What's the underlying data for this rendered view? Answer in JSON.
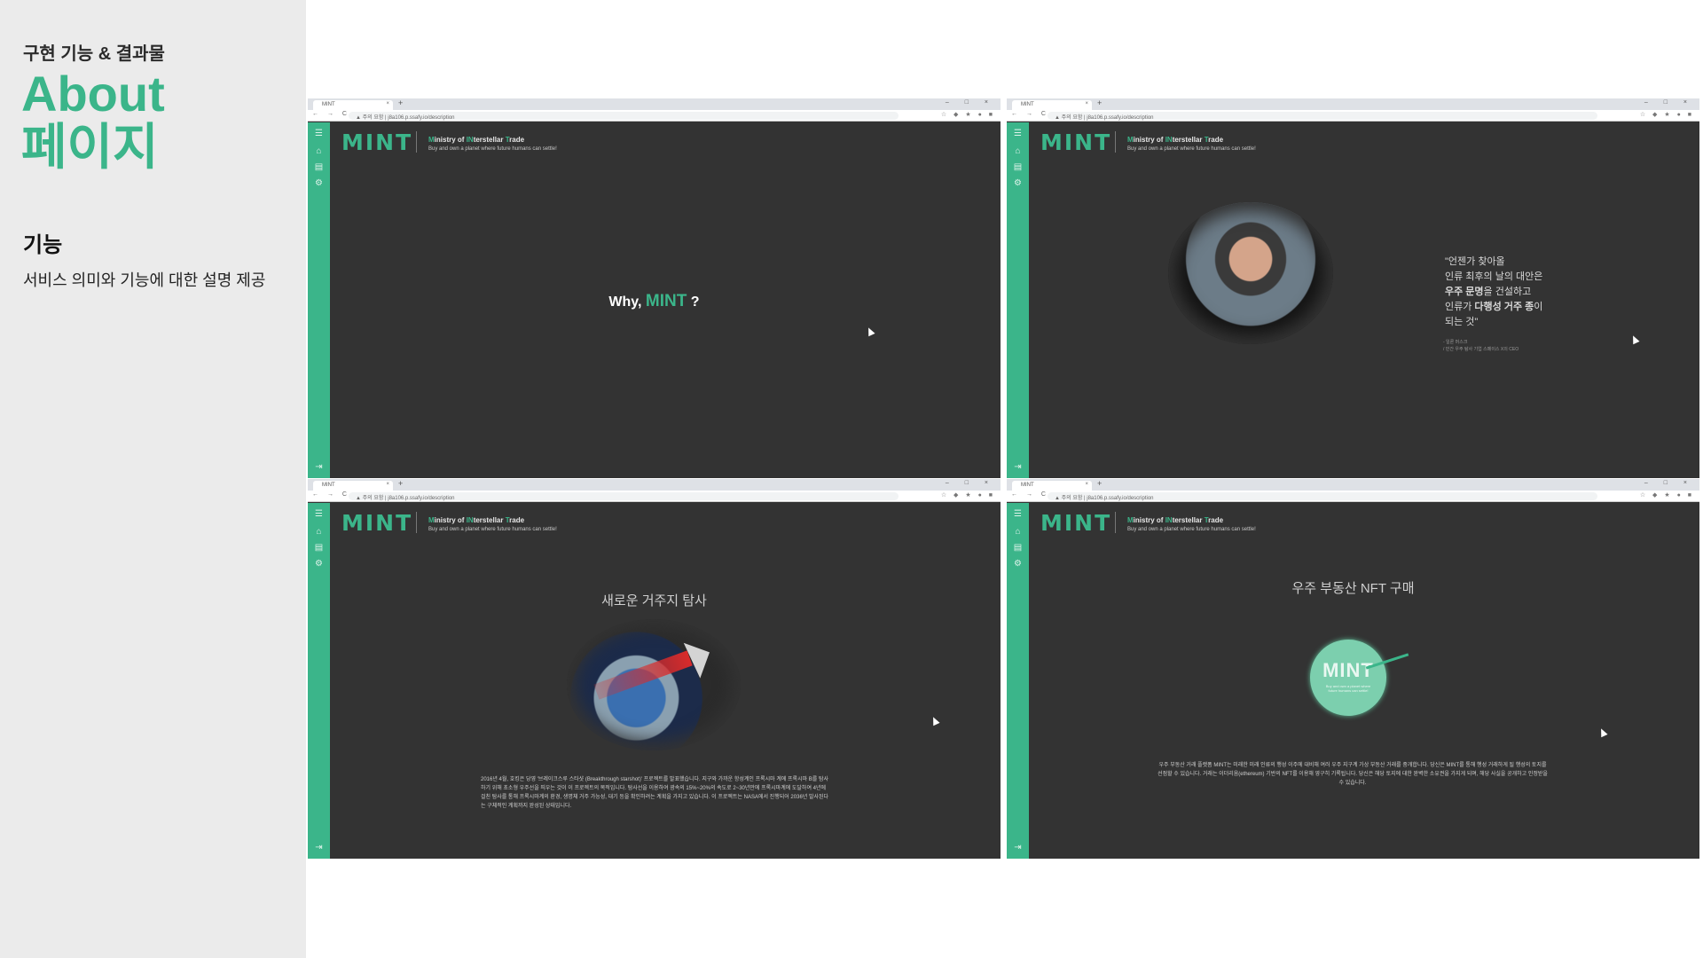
{
  "slide": {
    "kicker": "구현 기능 & 결과물",
    "title_line1": "About",
    "title_line2": "페이지",
    "section_label": "기능",
    "section_desc": "서비스 의미와 기능에 대한 설명 제공"
  },
  "browser": {
    "tab_title": "MINT",
    "tab_close": "×",
    "new_tab": "+",
    "window_controls": "‒ □ ×",
    "nav_buttons": "← → C",
    "url": "▲ 주의 요함 | j8a106.p.ssafy.io/description",
    "extension_icons": "☆ ◆ ★ ● ■"
  },
  "app": {
    "logo": "MINT",
    "title_prefix_1": "M",
    "title_part_1": "inistry of ",
    "title_prefix_2": "IN",
    "title_part_2": "terstellar ",
    "title_prefix_3": "T",
    "title_part_3": "rade",
    "subtitle": "Buy and own a planet where future humans can settle!",
    "sidebar_icons": [
      "menu-icon",
      "home-icon",
      "document-icon",
      "settings-icon",
      "logout-icon"
    ],
    "accent_color": "#3bb58a"
  },
  "frame1": {
    "why_prefix": "Why, ",
    "why_brand": "MINT",
    "why_suffix": " ?"
  },
  "frame2": {
    "quote_line1": "\"언젠가 찾아올",
    "quote_line2": "인류 최후의 날의 대안은",
    "quote_line3_bold": "우주 문명",
    "quote_line3_rest": "을 건설하고",
    "quote_line4_pre": "인류가 ",
    "quote_line4_bold": "다행성 거주 종",
    "quote_line4_rest": "이",
    "quote_line5": "되는 것\"",
    "attr_line1": "- 일론 머스크",
    "attr_line2": "/ 민간 우주 탐사 기업 스페이스 X의 CEO"
  },
  "frame3": {
    "heading": "새로운 거주지 탐사",
    "paragraph": "2016년 4월, 호킹은 당영 '브레이크스루 스타샷 (Breakthrough starshot)' 프로젝트를 발표했습니다. 지구와 가까운 항성계인 프록시마 계에 프록시마 B를 탐사하기 위해 초소형 우주선을 띄우는 것이 이 프로젝트의 목적입니다. 탐사선을 이용하여 광속의 15%~20%의 속도로 2~30년만에 프록시마계에 도달하여 4년에 걸친 탐사를 통해 프록시마계의 환경, 생명체 거주 가능성, 대기 등을 확인하려는 계획을 가지고 있습니다. 이 프로젝트는 NASA에서 진행되어 2036년 발사된다는 구체적인 계획까지 완성된 상태입니다."
  },
  "frame4": {
    "heading": "우주 부동산 NFT 구매",
    "coin_logo": "MINT",
    "coin_sub": "Buy and own a planet where future humans can settle!",
    "paragraph": "우주 부동산 거래 플랫폼 MINT는 미래한 미래 인류의 행성 이주에 대비해 여러 우주 지구계 가상 부동산 거래를 중개합니다. 당신은 MINT를 통해 행성 거래하게 될 행성의 토지를 선점할 수 있습니다. 거래는 이더리움(ethereum) 기반의 NFT를 이용해 영구히 기록됩니다. 당신은 해당 토지에 대한 완벽한 소유권을 가지게 되며, 해당 사실을 공개하고 인정받을 수 있습니다."
  }
}
